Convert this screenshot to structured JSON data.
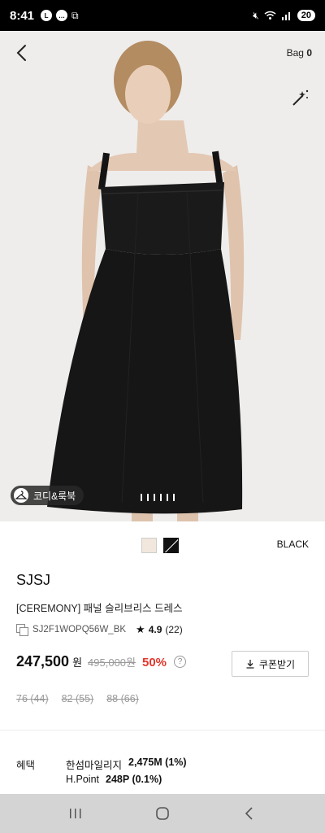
{
  "status_bar": {
    "time": "8:41",
    "battery": "20",
    "left_icons": [
      "line-icon",
      "talk-icon",
      "screenshot-icon"
    ],
    "right_icons": [
      "mute-icon",
      "wifi-icon",
      "signal-icon",
      "battery-icon"
    ]
  },
  "header": {
    "bag_label": "Bag",
    "bag_count": "0"
  },
  "image": {
    "look_label": "코디&룩북",
    "pager_count": 6
  },
  "colors": {
    "selected_name": "BLACK",
    "swatches": [
      "#f1e7dd",
      "#111111"
    ],
    "discount": "#e2362c"
  },
  "product": {
    "brand": "SJSJ",
    "name": "[CEREMONY] 패널 슬리브리스 드레스",
    "code": "SJ2F1WOPQ56W_BK",
    "rating": "4.9",
    "review_count": "(22)"
  },
  "pricing": {
    "price": "247,500",
    "currency": "원",
    "original_price": "495,000원",
    "discount_rate": "50%",
    "help_icon": "?",
    "coupon_label": "쿠폰받기"
  },
  "sizes": [
    "76 (44)",
    "82 (55)",
    "88 (66)"
  ],
  "benefits": {
    "label": "혜택",
    "items": [
      {
        "name": "한섬마일리지",
        "value": "2,475M (1%)"
      },
      {
        "name": "H.Point",
        "value": "248P (0.1%)"
      }
    ]
  },
  "nav": [
    "recents-icon",
    "home-icon",
    "back-icon"
  ]
}
